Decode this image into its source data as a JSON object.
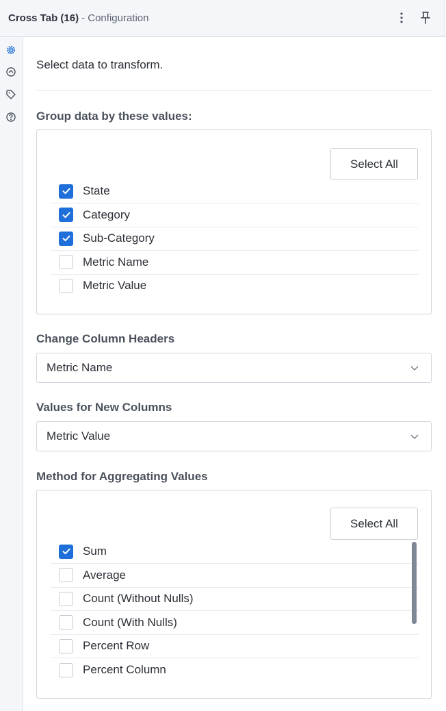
{
  "header": {
    "tool_name": "Cross Tab (16)",
    "subtitle": "- Configuration",
    "more_icon": "vertical-ellipsis-icon",
    "pin_icon": "pin-icon"
  },
  "sidebar": {
    "icons": [
      "gear-icon",
      "annotation-icon",
      "tag-icon",
      "help-icon"
    ],
    "active_color": "#1e6fd9"
  },
  "intro_text": "Select data to transform.",
  "group_by": {
    "label": "Group data by these values:",
    "select_all_label": "Select All",
    "items": [
      {
        "label": "State",
        "checked": true
      },
      {
        "label": "Category",
        "checked": true
      },
      {
        "label": "Sub-Category",
        "checked": true
      },
      {
        "label": "Metric Name",
        "checked": false
      },
      {
        "label": "Metric Value",
        "checked": false
      }
    ]
  },
  "column_headers": {
    "label": "Change Column Headers",
    "value": "Metric Name"
  },
  "new_column_values": {
    "label": "Values for New Columns",
    "value": "Metric Value"
  },
  "aggregation": {
    "label": "Method for Aggregating Values",
    "select_all_label": "Select All",
    "items": [
      {
        "label": "Sum",
        "checked": true
      },
      {
        "label": "Average",
        "checked": false
      },
      {
        "label": "Count (Without Nulls)",
        "checked": false
      },
      {
        "label": "Count (With Nulls)",
        "checked": false
      },
      {
        "label": "Percent Row",
        "checked": false
      },
      {
        "label": "Percent Column",
        "checked": false
      }
    ]
  },
  "colors": {
    "accent": "#1e6fd9",
    "panel_bg": "#f4f6f9"
  }
}
